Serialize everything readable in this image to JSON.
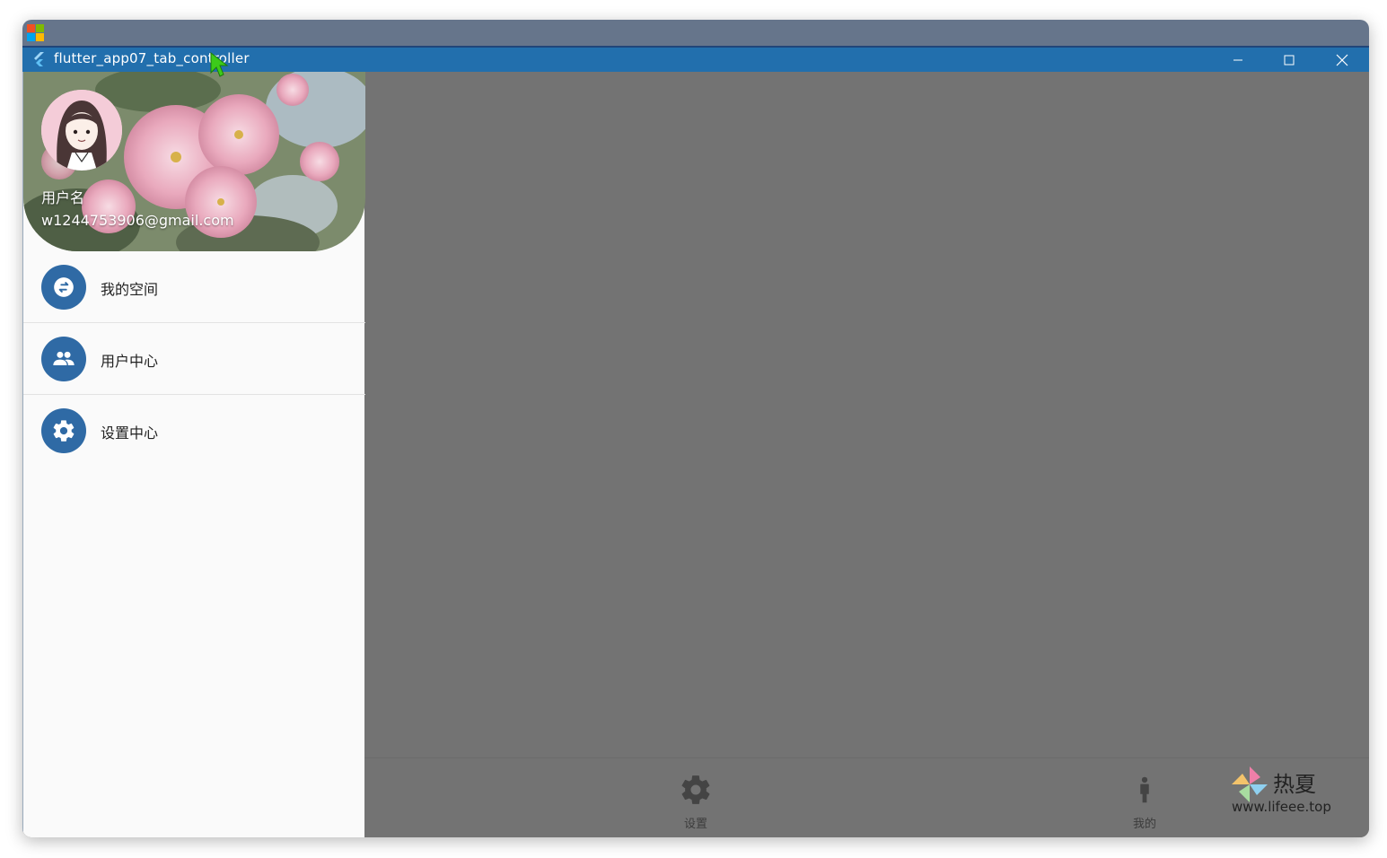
{
  "window": {
    "title": "flutter_app07_tab_controller"
  },
  "drawer": {
    "header": {
      "username": "用户名",
      "email": "w1244753906@gmail.com"
    },
    "items": [
      {
        "label": "我的空间",
        "icon": "swap-horiz-icon"
      },
      {
        "label": "用户中心",
        "icon": "people-icon"
      },
      {
        "label": "设置中心",
        "icon": "settings-icon"
      }
    ]
  },
  "bottom_nav": {
    "tabs": [
      {
        "label": "设置",
        "icon": "settings-icon"
      },
      {
        "label": "我的",
        "icon": "person-icon"
      }
    ]
  },
  "watermark": {
    "brand": "热夏",
    "url": "www.lifeee.top"
  },
  "colors": {
    "titlebar": "#226fad",
    "topstrip": "#66758b",
    "accent": "#2f6aa5",
    "scrim": "#737373",
    "drawer_bg": "#fafafa"
  }
}
